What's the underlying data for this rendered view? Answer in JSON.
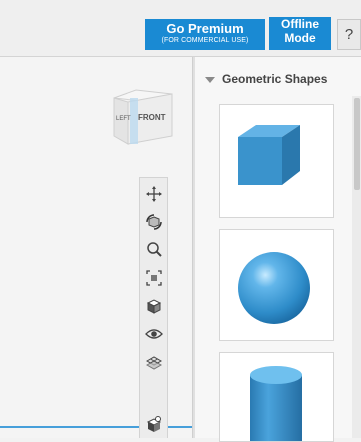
{
  "header": {
    "premium_title": "Go Premium",
    "premium_subtitle": "(FOR COMMERCIAL USE)",
    "offline_line1": "Offline",
    "offline_line2": "Mode",
    "help_label": "?"
  },
  "viewcube": {
    "left_face": "LEFT",
    "front_face": "FRONT"
  },
  "toolbar": {
    "tools": [
      "pan-icon",
      "orbit-icon",
      "zoom-icon",
      "fit-view-icon",
      "perspective-icon",
      "visibility-icon",
      "grid-icon",
      "material-icon"
    ]
  },
  "panel": {
    "title": "Geometric Shapes",
    "items": [
      "box",
      "sphere",
      "cylinder"
    ]
  },
  "colors": {
    "accent": "#1a8ad3",
    "shape": "#3a93cc"
  }
}
